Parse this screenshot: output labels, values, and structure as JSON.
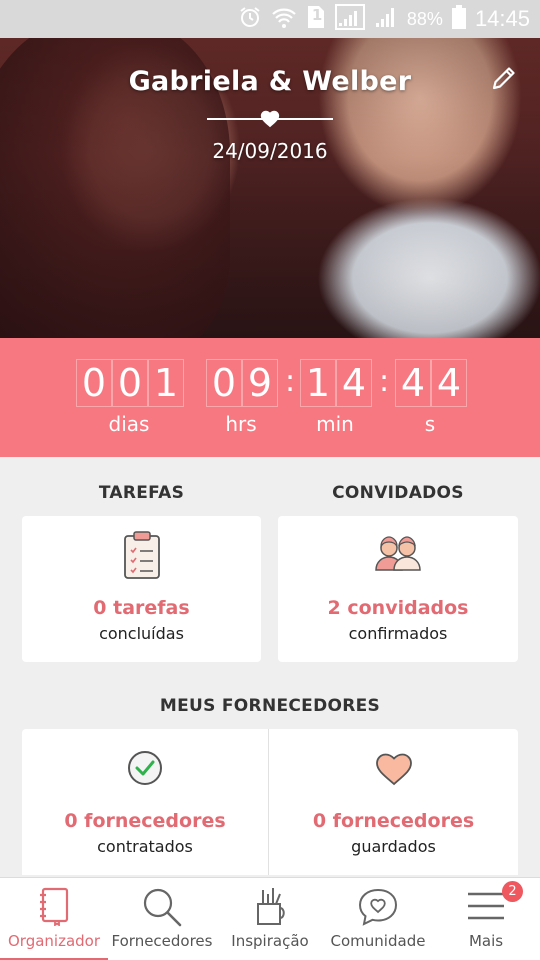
{
  "status_bar": {
    "battery_percent": "88%",
    "time": "14:45",
    "sim_label": "1",
    "icons": [
      "alarm-icon",
      "wifi-icon",
      "sim-icon",
      "signal-icon",
      "signal-icon",
      "battery-icon"
    ]
  },
  "hero": {
    "title": "Gabriela & Welber",
    "date": "24/09/2016",
    "edit_icon": "pencil-icon"
  },
  "countdown": {
    "days_digits": [
      "0",
      "0",
      "1"
    ],
    "hours_digits": [
      "0",
      "9"
    ],
    "minutes_digits": [
      "1",
      "4"
    ],
    "seconds_digits": [
      "4",
      "4"
    ],
    "labels": {
      "days": "dias",
      "hours": "hrs",
      "minutes": "min",
      "seconds": "s"
    },
    "background_color": "#f77880"
  },
  "sections": {
    "tasks_heading": "TAREFAS",
    "guests_heading": "CONVIDADOS",
    "vendors_heading": "MEUS FORNECEDORES"
  },
  "cards": {
    "tasks": {
      "count": "0 tarefas",
      "sub": "concluídas",
      "icon": "clipboard-icon"
    },
    "guests": {
      "count": "2 convidados",
      "sub": "confirmados",
      "icon": "guests-icon"
    },
    "vendors_hired": {
      "count": "0 fornecedores",
      "sub": "contratados",
      "icon": "check-circle-icon"
    },
    "vendors_saved": {
      "count": "0 fornecedores",
      "sub": "guardados",
      "icon": "heart-icon"
    }
  },
  "bottom_nav": {
    "items": [
      {
        "label": "Organizador",
        "icon": "notebook-icon",
        "active": true
      },
      {
        "label": "Fornecedores",
        "icon": "search-icon",
        "active": false
      },
      {
        "label": "Inspiração",
        "icon": "pencil-cup-icon",
        "active": false
      },
      {
        "label": "Comunidade",
        "icon": "chat-heart-icon",
        "active": false
      },
      {
        "label": "Mais",
        "icon": "menu-icon",
        "active": false,
        "badge": "2"
      }
    ]
  },
  "colors": {
    "accent": "#e26a72",
    "countdown_bg": "#f77880",
    "page_bg": "#efefef"
  }
}
